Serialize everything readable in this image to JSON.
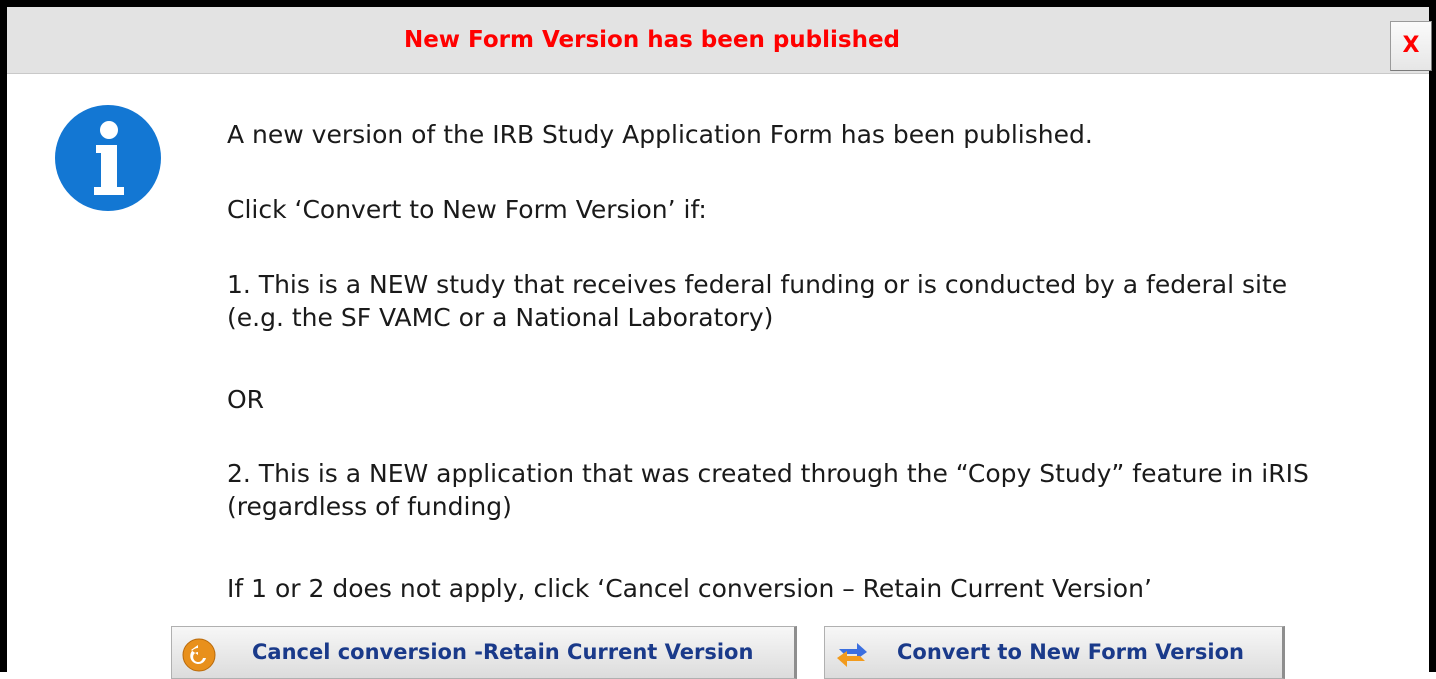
{
  "dialog": {
    "title": "New Form Version has been published",
    "close_label": "X",
    "title_color": "#ff0000"
  },
  "message": {
    "icon": "info-icon",
    "line1": "A new version of the IRB Study Application Form has been published.",
    "line2": "Click ‘Convert to New Form Version’ if:",
    "line3": "1. This is a NEW study that receives federal funding or is conducted by a federal site (e.g. the SF VAMC or a National Laboratory)",
    "line4": "OR",
    "line5": "2. This is a NEW application that was created through the “Copy Study” feature in iRIS (regardless of funding)",
    "line6": "If 1 or 2 does not apply, click ‘Cancel conversion – Retain Current Version’"
  },
  "buttons": {
    "cancel_label": "Cancel conversion -Retain Current Version",
    "cancel_icon": "undo-arrow-icon",
    "convert_label": "Convert to New Form Version",
    "convert_icon": "swap-arrows-icon"
  }
}
